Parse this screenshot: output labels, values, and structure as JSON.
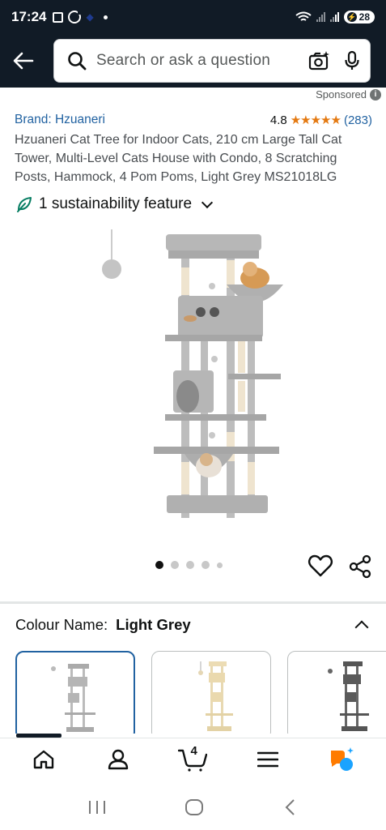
{
  "status_bar": {
    "time": "17:24",
    "battery": "28",
    "icons": [
      "screenshot-icon",
      "sync-icon",
      "app-icon",
      "notification-dot",
      "wifi-icon",
      "signal-icon",
      "signal-icon",
      "battery-icon"
    ]
  },
  "header": {
    "search_placeholder": "Search or ask a question"
  },
  "sponsored_label": "Sponsored",
  "product": {
    "brand": "Brand: Hzuaneri",
    "rating_value": "4.8",
    "stars": "★★★★★",
    "rating_count": "(283)",
    "title": "Hzuaneri Cat Tree for Indoor Cats, 210 cm Large Tall Cat Tower, Multi-Level Cats House with Condo, 8 Scratching Posts, Hammock, 4 Pom Poms, Light Grey MS21018LG",
    "sustainability": "1 sustainability feature",
    "image_count": 5,
    "active_image_index": 0
  },
  "variation": {
    "label": "Colour Name:",
    "value": "Light Grey",
    "swatches": [
      "light-grey",
      "beige",
      "dark-grey"
    ]
  },
  "colors": {
    "header_bg": "#111b26",
    "link": "#2162a1",
    "star": "#e47911",
    "leaf": "#067d62",
    "alexa_orange": "#ff7b00",
    "alexa_blue": "#1aa3ff"
  },
  "bottom_nav": {
    "cart_count": "4",
    "items": [
      "home-icon",
      "account-icon",
      "cart-icon",
      "menu-icon",
      "rufus-icon"
    ]
  }
}
